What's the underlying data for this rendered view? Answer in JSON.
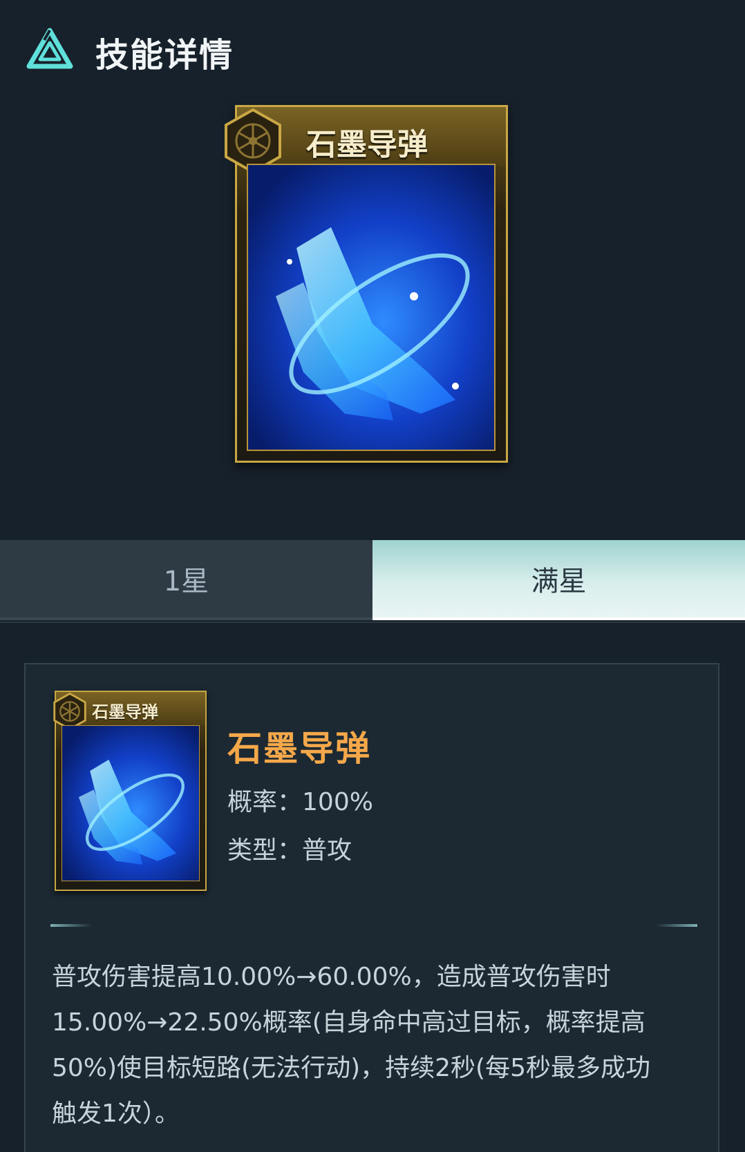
{
  "header": {
    "title": "技能详情",
    "logo_icon": "triangle-logo-icon"
  },
  "card": {
    "name": "石墨导弹",
    "emblem_icon": "hexagon-emblem-icon",
    "art_icon": "blue-boots-art-icon"
  },
  "tabs": [
    {
      "label": "1星",
      "selected": false
    },
    {
      "label": "满星",
      "selected": true
    }
  ],
  "detail": {
    "card_name": "石墨导弹",
    "name": "石墨导弹",
    "probability_label": "概率：",
    "probability_value": "100%",
    "type_label": "类型：",
    "type_value": "普攻",
    "description_lines": [
      "普攻伤害提高10.00%→60.00%，造成普攻伤害时",
      "15.00%→22.50%概率(自身命中高过目标，概率提高",
      "50%)使目标短路(无法行动)，持续2秒(每5秒最多成功",
      "触发1次）。"
    ]
  },
  "colors": {
    "accent_orange": "#f5a84a",
    "tab_selected": "#d8eeec",
    "card_gold": "#c9a745"
  }
}
